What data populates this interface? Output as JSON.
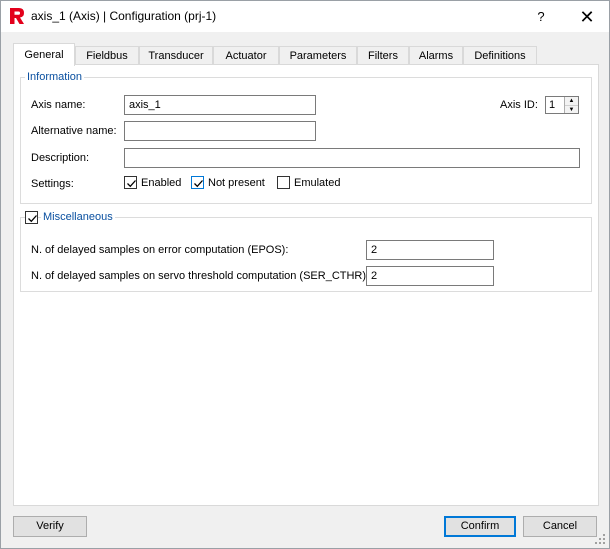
{
  "window": {
    "title": "axis_1 (Axis) | Configuration (prj-1)",
    "help_label": "?",
    "close_label": "✕",
    "accent_color": "#0078d7",
    "icon_color": "#e3001b"
  },
  "tabs": [
    {
      "label": "General",
      "active": true
    },
    {
      "label": "Fieldbus",
      "active": false
    },
    {
      "label": "Transducer",
      "active": false
    },
    {
      "label": "Actuator",
      "active": false
    },
    {
      "label": "Parameters",
      "active": false
    },
    {
      "label": "Filters",
      "active": false
    },
    {
      "label": "Alarms",
      "active": false
    },
    {
      "label": "Definitions",
      "active": false
    }
  ],
  "information": {
    "legend": "Information",
    "axis_name_label": "Axis name:",
    "axis_name_value": "axis_1",
    "axis_id_label": "Axis ID:",
    "axis_id_value": "1",
    "alt_name_label": "Alternative name:",
    "alt_name_value": "",
    "description_label": "Description:",
    "description_value": "",
    "settings_label": "Settings:",
    "settings": [
      {
        "label": "Enabled",
        "checked": true
      },
      {
        "label": "Not present",
        "checked": true
      },
      {
        "label": "Emulated",
        "checked": false
      }
    ]
  },
  "miscellaneous": {
    "legend": "Miscellaneous",
    "checked": true,
    "epos_label": "N. of delayed samples on error computation (EPOS):",
    "epos_value": "2",
    "ser_cthr_label": "N. of delayed samples on servo threshold computation (SER_CTHR):",
    "ser_cthr_value": "2"
  },
  "footer": {
    "verify_label": "Verify",
    "confirm_label": "Confirm",
    "cancel_label": "Cancel"
  }
}
